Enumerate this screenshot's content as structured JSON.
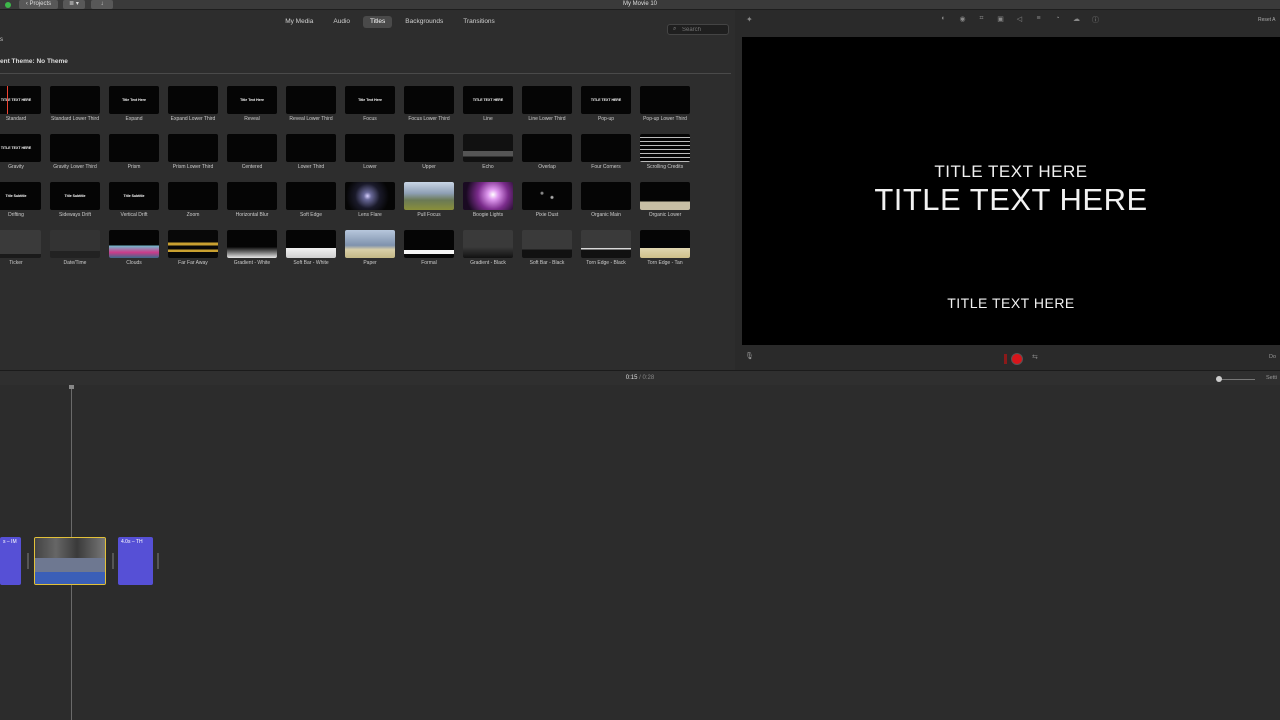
{
  "app": {
    "title": "My Movie 10",
    "projects_label": "Projects",
    "view_icon": "≣ ▾",
    "import_icon": "↓"
  },
  "browser": {
    "tabs": [
      {
        "label": "My Media",
        "active": false
      },
      {
        "label": "Audio",
        "active": false
      },
      {
        "label": "Titles",
        "active": true
      },
      {
        "label": "Backgrounds",
        "active": false
      },
      {
        "label": "Transitions",
        "active": false
      }
    ],
    "search_placeholder": "Search",
    "left_label": "s",
    "theme_label": "ent Theme: No Theme",
    "titles": [
      {
        "label": "Standard",
        "thumb": "TITLE TEXT HERE",
        "style": "black"
      },
      {
        "label": "Standard Lower Third",
        "thumb": "",
        "style": "black"
      },
      {
        "label": "Expand",
        "thumb": "Title Text Here",
        "style": "black"
      },
      {
        "label": "Expand Lower Third",
        "thumb": "",
        "style": "black"
      },
      {
        "label": "Reveal",
        "thumb": "Title Text Here",
        "style": "black"
      },
      {
        "label": "Reveal Lower Third",
        "thumb": "",
        "style": "black"
      },
      {
        "label": "Focus",
        "thumb": "Title Text Here",
        "style": "black"
      },
      {
        "label": "Focus Lower Third",
        "thumb": "",
        "style": "black"
      },
      {
        "label": "Line",
        "thumb": "TITLE TEXT HERE",
        "style": "black"
      },
      {
        "label": "Line Lower Third",
        "thumb": "",
        "style": "black"
      },
      {
        "label": "Pop-up",
        "thumb": "TITLE TEXT HERE",
        "style": "black"
      },
      {
        "label": "Pop-up Lower Third",
        "thumb": "",
        "style": "black"
      },
      {
        "label": "Gravity",
        "thumb": "TITLE TEXT HERE",
        "style": "black"
      },
      {
        "label": "Gravity Lower Third",
        "thumb": "",
        "style": "black"
      },
      {
        "label": "Prism",
        "thumb": "",
        "style": "black"
      },
      {
        "label": "Prism Lower Third",
        "thumb": "",
        "style": "black"
      },
      {
        "label": "Centered",
        "thumb": "",
        "style": "black"
      },
      {
        "label": "Lower Third",
        "thumb": "",
        "style": "black"
      },
      {
        "label": "Lower",
        "thumb": "",
        "style": "black"
      },
      {
        "label": "Upper",
        "thumb": "",
        "style": "black"
      },
      {
        "label": "Echo",
        "thumb": "",
        "style": "echo"
      },
      {
        "label": "Overlap",
        "thumb": "",
        "style": "black"
      },
      {
        "label": "Four Corners",
        "thumb": "",
        "style": "black"
      },
      {
        "label": "Scrolling Credits",
        "thumb": "",
        "style": "credits"
      },
      {
        "label": "Drifting",
        "thumb": "Title Subtitle",
        "style": "black"
      },
      {
        "label": "Sideways Drift",
        "thumb": "Title Subtitle",
        "style": "black"
      },
      {
        "label": "Vertical Drift",
        "thumb": "Title Subtitle",
        "style": "black"
      },
      {
        "label": "Zoom",
        "thumb": "",
        "style": "black"
      },
      {
        "label": "Horizontal Blur",
        "thumb": "",
        "style": "black"
      },
      {
        "label": "Soft Edge",
        "thumb": "",
        "style": "black"
      },
      {
        "label": "Lens Flare",
        "thumb": "",
        "style": "flare"
      },
      {
        "label": "Pull Focus",
        "thumb": "",
        "style": "landscape"
      },
      {
        "label": "Boogie Lights",
        "thumb": "",
        "style": "boogie"
      },
      {
        "label": "Pixie Dust",
        "thumb": "",
        "style": "dust"
      },
      {
        "label": "Organic Main",
        "thumb": "",
        "style": "black"
      },
      {
        "label": "Organic Lower",
        "thumb": "",
        "style": "organic"
      },
      {
        "label": "Ticker",
        "thumb": "",
        "style": "ticker"
      },
      {
        "label": "Date/Time",
        "thumb": "",
        "style": "datetime"
      },
      {
        "label": "Clouds",
        "thumb": "",
        "style": "clouds"
      },
      {
        "label": "Far Far Away",
        "thumb": "",
        "style": "faraway"
      },
      {
        "label": "Gradient - White",
        "thumb": "",
        "style": "gradwhite"
      },
      {
        "label": "Soft Bar - White",
        "thumb": "",
        "style": "softwhite"
      },
      {
        "label": "Paper",
        "thumb": "",
        "style": "paper"
      },
      {
        "label": "Formal",
        "thumb": "",
        "style": "formal"
      },
      {
        "label": "Gradient - Black",
        "thumb": "",
        "style": "gradblack"
      },
      {
        "label": "Soft Bar - Black",
        "thumb": "",
        "style": "softblack"
      },
      {
        "label": "Torn Edge - Black",
        "thumb": "",
        "style": "tornblack"
      },
      {
        "label": "Torn Edge - Tan",
        "thumb": "",
        "style": "torntan"
      }
    ]
  },
  "viewer": {
    "line1": "TITLE TEXT HERE",
    "line2": "TITLE TEXT HERE",
    "line3": "TITLE TEXT HERE",
    "reset_label": "Reset A",
    "done_label": "Do",
    "record_color": "#d7151b"
  },
  "timeline": {
    "current_time": "0:15",
    "separator": "/",
    "total_time": "0:28",
    "settings_label": "Setti",
    "clip_left_label": "s – IM",
    "clip_right_label": "4.0s – TH"
  },
  "colors": {
    "title_clip": "#5650d6",
    "selection": "#e2c13a"
  }
}
